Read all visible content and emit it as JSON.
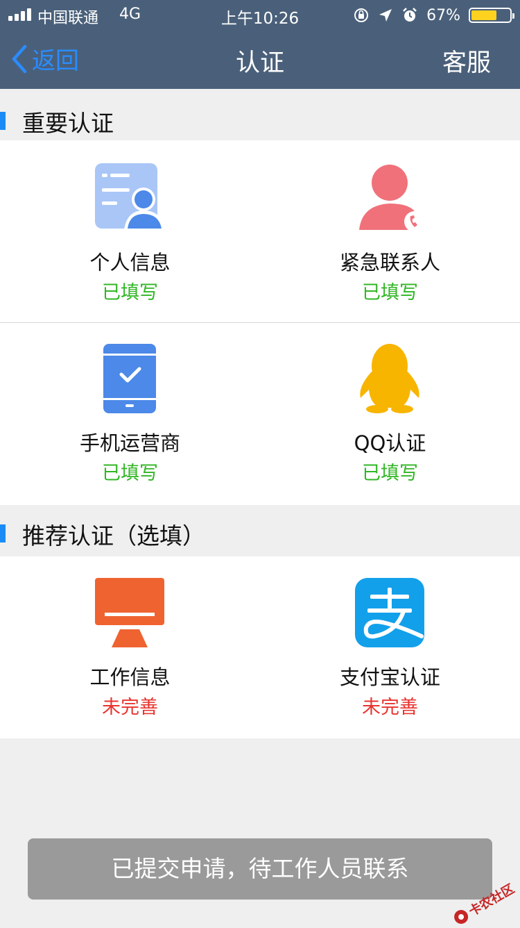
{
  "status_bar": {
    "carrier": "中国联通",
    "network": "4G",
    "time": "上午10:26",
    "battery_percent": "67%",
    "battery_level": 0.67,
    "icons": [
      "orientation-lock-icon",
      "location-icon",
      "alarm-icon",
      "battery-icon"
    ]
  },
  "nav": {
    "back_label": "返回",
    "title": "认证",
    "right_label": "客服"
  },
  "sections": [
    {
      "title": "重要认证",
      "items": [
        {
          "label": "个人信息",
          "status": "已填写",
          "icon": "id-card-icon"
        },
        {
          "label": "紧急联系人",
          "status": "已填写",
          "icon": "contact-phone-icon"
        },
        {
          "label": "手机运营商",
          "status": "已填写",
          "icon": "phone-verified-icon"
        },
        {
          "label": "QQ认证",
          "status": "已填写",
          "icon": "qq-penguin-icon"
        }
      ]
    },
    {
      "title": "推荐认证（选填）",
      "items": [
        {
          "label": "工作信息",
          "status": "未完善",
          "icon": "work-monitor-icon"
        },
        {
          "label": "支付宝认证",
          "status": "未完善",
          "icon": "alipay-icon"
        }
      ]
    }
  ],
  "toast": "已提交申请，待工作人员联系",
  "watermark": "卡农社区",
  "colors": {
    "nav_bg": "#4a607a",
    "accent_blue": "#1b8cf6",
    "done_green": "#30b624",
    "todo_red": "#e8342f"
  }
}
